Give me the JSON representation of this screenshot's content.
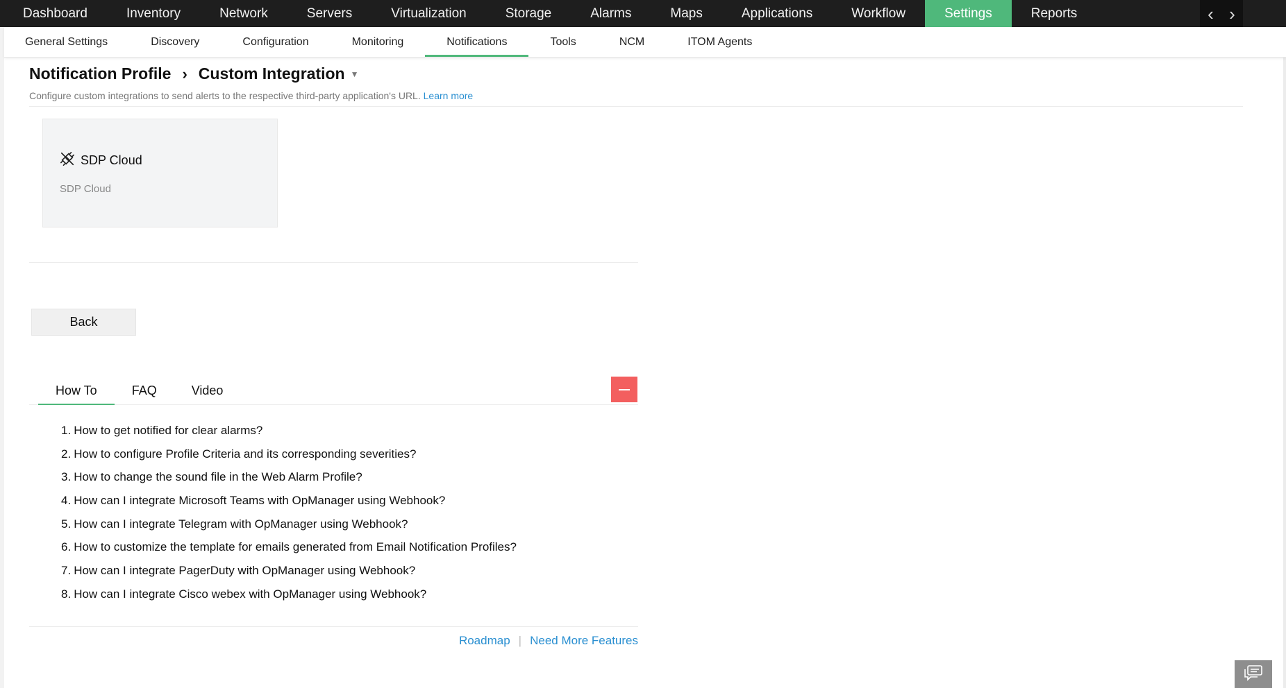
{
  "topnav": {
    "items": [
      "Dashboard",
      "Inventory",
      "Network",
      "Servers",
      "Virtualization",
      "Storage",
      "Alarms",
      "Maps",
      "Applications",
      "Workflow",
      "Settings",
      "Reports"
    ],
    "active": "Settings",
    "prev_icon": "chevron-left-icon",
    "next_icon": "chevron-right-icon"
  },
  "subnav": {
    "items": [
      "General Settings",
      "Discovery",
      "Configuration",
      "Monitoring",
      "Notifications",
      "Tools",
      "NCM",
      "ITOM Agents"
    ],
    "active": "Notifications"
  },
  "header": {
    "breadcrumb_root": "Notification Profile",
    "breadcrumb_sep": "›",
    "breadcrumb_current": "Custom Integration",
    "description": "Configure custom integrations to send alerts to the respective third-party application's URL.",
    "learn_more": "Learn more"
  },
  "card": {
    "icon": "plug-link-icon",
    "title": "SDP Cloud",
    "subtitle": "SDP Cloud"
  },
  "back_button": "Back",
  "help": {
    "tabs": [
      "How To",
      "FAQ",
      "Video"
    ],
    "active_tab": "How To",
    "items": [
      "How to get notified for clear alarms?",
      "How to configure Profile Criteria and its corresponding severities?",
      "How to change the sound file in the Web Alarm Profile?",
      "How can I integrate Microsoft Teams with OpManager using Webhook?",
      "How can I integrate Telegram with OpManager using Webhook?",
      "How to customize the template for emails generated from Email Notification Profiles?",
      "How can I integrate PagerDuty with OpManager using Webhook?",
      "How can I integrate Cisco webex with OpManager using Webhook?"
    ]
  },
  "footer": {
    "roadmap": "Roadmap",
    "separator": "|",
    "need_more": "Need More Features"
  },
  "colors": {
    "nav_bg": "#1e1e1e",
    "accent_green": "#4fb87b",
    "link_blue": "#2a8fd1",
    "collapse_red": "#f35f5f"
  }
}
